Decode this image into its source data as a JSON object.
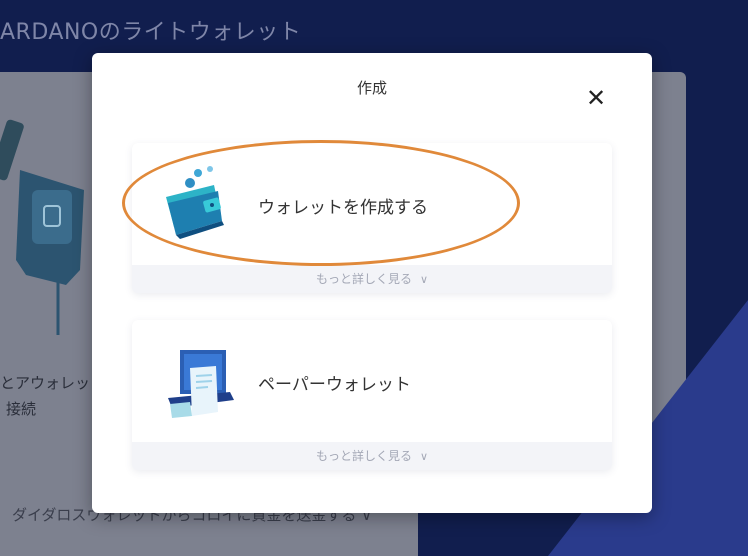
{
  "background": {
    "title": "ARDANOのライトウォレット",
    "connect_line1": "とアウォレット",
    "connect_line2": "接続",
    "transfer_text": "ダイダロスウォレットからコロイに資金を送金する ∨"
  },
  "modal": {
    "title": "作成",
    "close_label": "✕",
    "options": [
      {
        "label": "ウォレットを作成する",
        "more_label": "もっと詳しく見る",
        "icon": "wallet-icon"
      },
      {
        "label": "ペーパーウォレット",
        "more_label": "もっと詳しく見る",
        "icon": "paper-wallet-icon"
      }
    ]
  },
  "colors": {
    "backdrop": "#111e4e",
    "dim_card": "#7d818f",
    "modal_bg": "#ffffff",
    "highlight": "#e0893a",
    "text": "#333333",
    "muted_text": "#a4a8b6"
  }
}
